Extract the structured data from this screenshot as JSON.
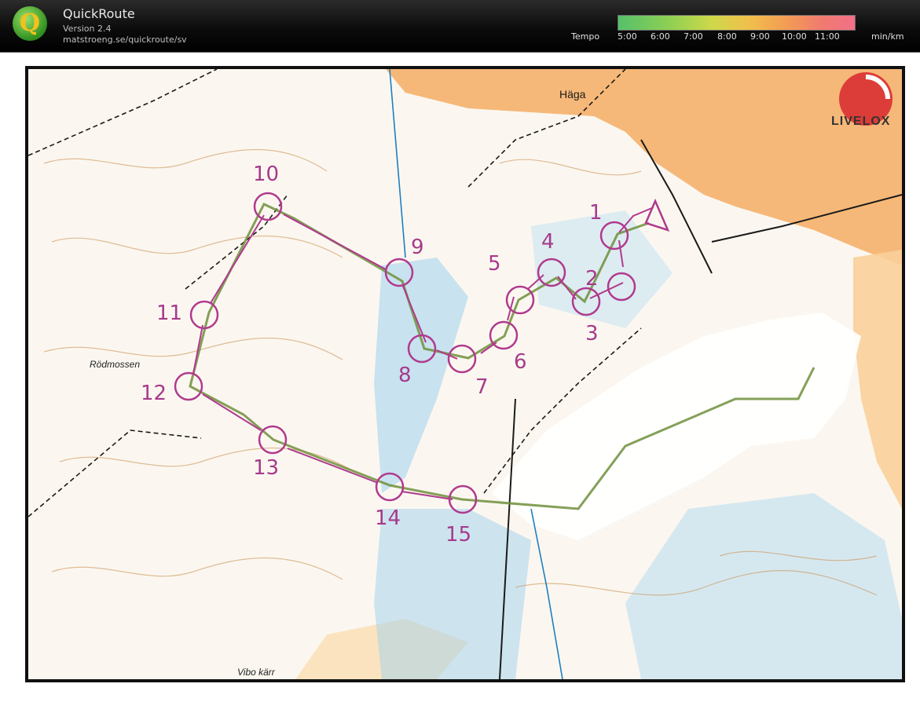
{
  "app": {
    "title": "QuickRoute",
    "version": "Version 2.4",
    "url": "matstroeng.se/quickroute/sv"
  },
  "tempo": {
    "label": "Tempo",
    "ticks": [
      "5:00",
      "6:00",
      "7:00",
      "8:00",
      "9:00",
      "10:00",
      "11:00"
    ],
    "unit": "min/km"
  },
  "map": {
    "place_labels": [
      "Häga",
      "Rödmossen",
      "Vibo kärr"
    ],
    "controls": [
      "1",
      "2",
      "3",
      "4",
      "5",
      "6",
      "7",
      "8",
      "9",
      "10",
      "11",
      "12",
      "13",
      "14",
      "15"
    ],
    "watermark": "LIVELOX",
    "colors": {
      "course": "#b03a8e",
      "route": "#6e8f3b",
      "open_land": "#f5b06a",
      "marsh": "#1e7fc0",
      "contour": "#c98a4b"
    }
  }
}
